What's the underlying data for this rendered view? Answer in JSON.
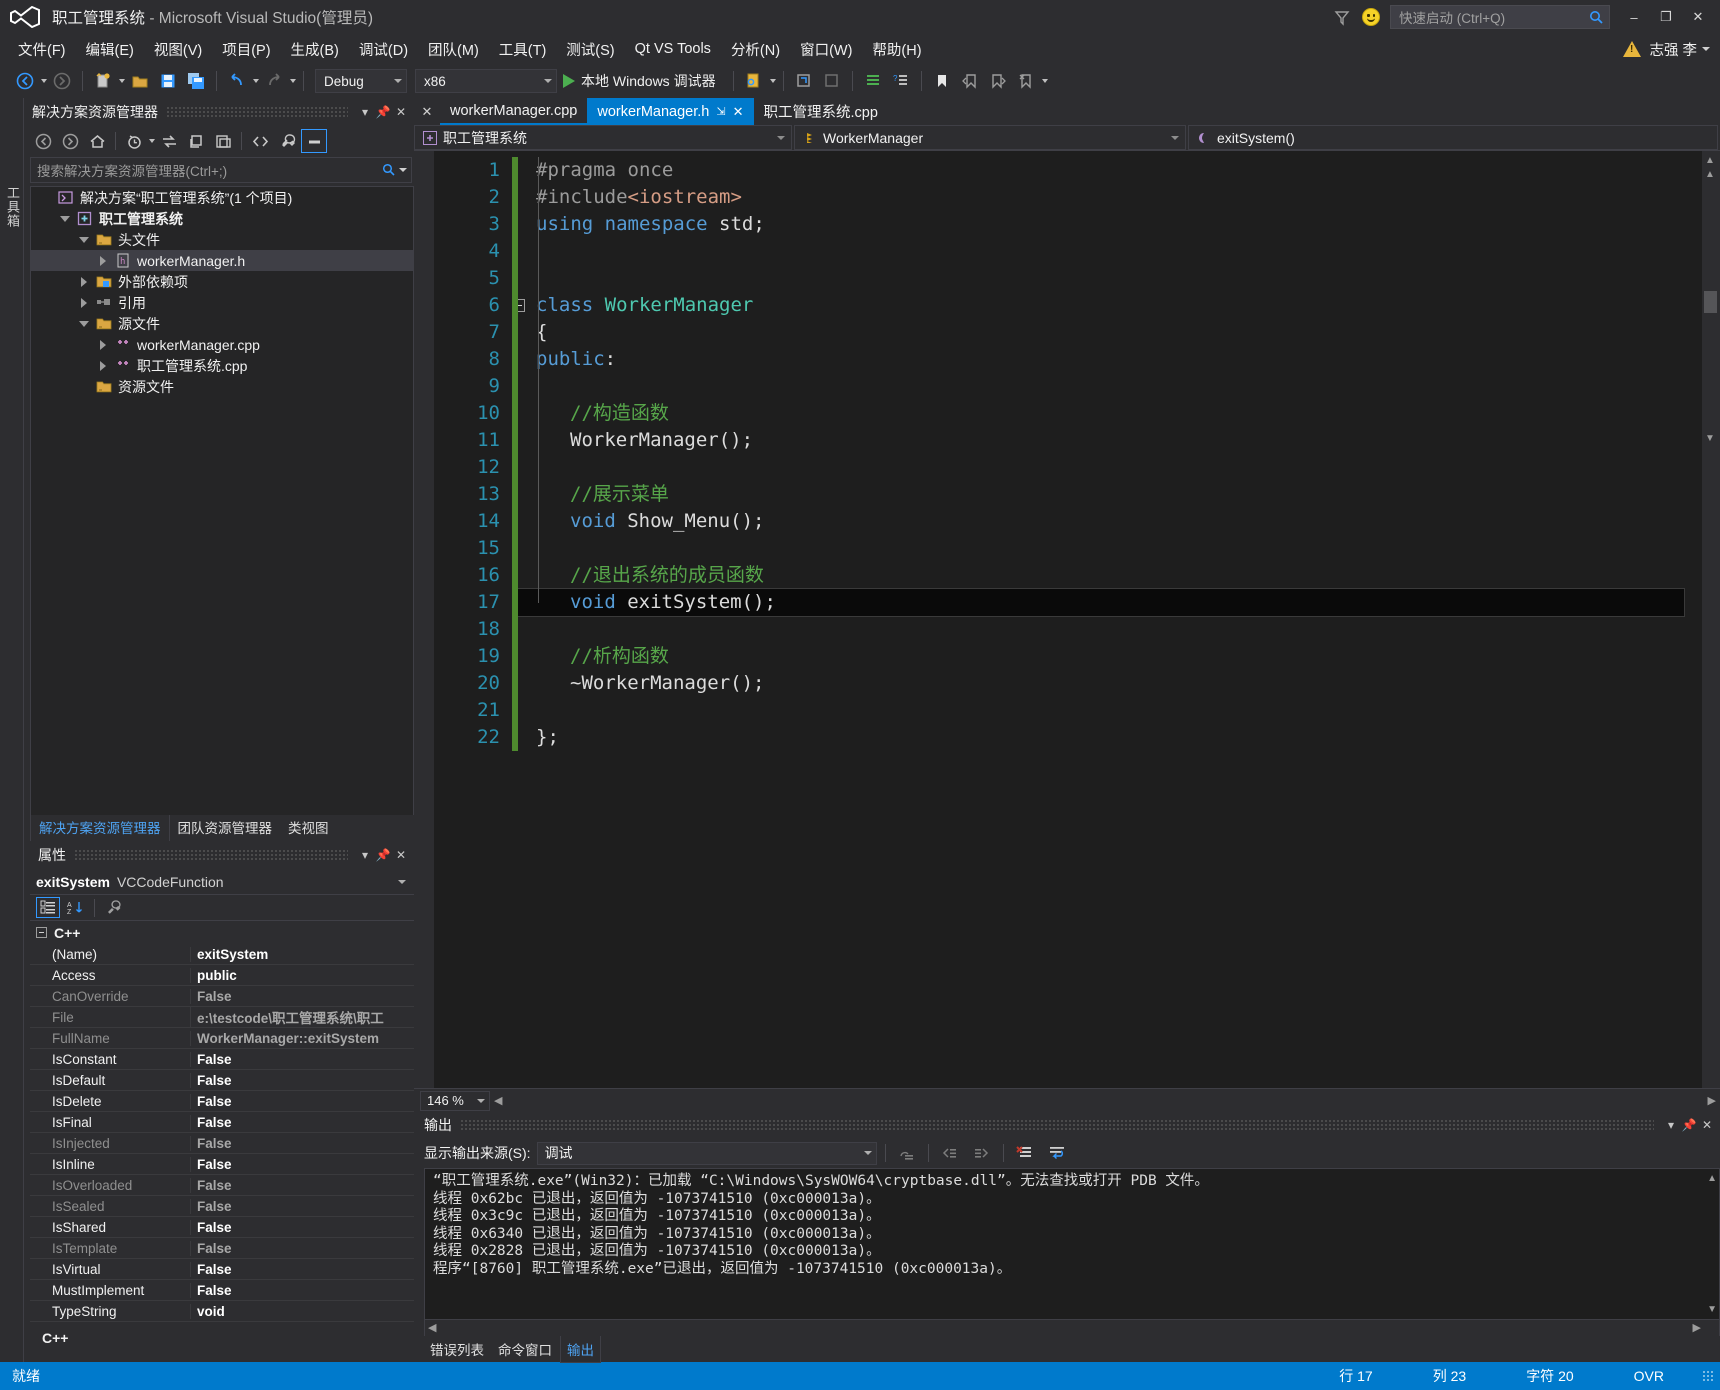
{
  "window": {
    "title_main": "职工管理系统",
    "title_rest": " - Microsoft Visual Studio(管理员)",
    "quick_launch_placeholder": "快速启动 (Ctrl+Q)",
    "minimize": "–",
    "maximize": "❐",
    "close": "✕"
  },
  "menu": {
    "items": [
      "文件(F)",
      "编辑(E)",
      "视图(V)",
      "项目(P)",
      "生成(B)",
      "调试(D)",
      "团队(M)",
      "工具(T)",
      "测试(S)",
      "Qt VS Tools",
      "分析(N)",
      "窗口(W)",
      "帮助(H)"
    ],
    "user": "志强 李"
  },
  "toolbar": {
    "configuration": "Debug",
    "platform": "x86",
    "run_label": "本地 Windows 调试器"
  },
  "solution_explorer": {
    "panel_title": "解决方案资源管理器",
    "search_placeholder": "搜索解决方案资源管理器(Ctrl+;)",
    "tree": [
      {
        "label": "解决方案“职工管理系统”(1 个项目)",
        "indent": 0,
        "twisty": "none",
        "icon": "solution-icon",
        "selected": false
      },
      {
        "label": "职工管理系统",
        "indent": 1,
        "twisty": "down",
        "icon": "project-icon",
        "selected": false,
        "bold": true
      },
      {
        "label": "头文件",
        "indent": 2,
        "twisty": "down",
        "icon": "folder-icon",
        "selected": false
      },
      {
        "label": "workerManager.h",
        "indent": 3,
        "twisty": "right",
        "icon": "header-file-icon",
        "selected": true
      },
      {
        "label": "外部依赖项",
        "indent": 2,
        "twisty": "right",
        "icon": "ext-deps-icon",
        "selected": false
      },
      {
        "label": "引用",
        "indent": 2,
        "twisty": "right",
        "icon": "references-icon",
        "selected": false
      },
      {
        "label": "源文件",
        "indent": 2,
        "twisty": "down",
        "icon": "folder-icon",
        "selected": false
      },
      {
        "label": "workerManager.cpp",
        "indent": 3,
        "twisty": "right",
        "icon": "cpp-file-icon",
        "selected": false
      },
      {
        "label": "职工管理系统.cpp",
        "indent": 3,
        "twisty": "right",
        "icon": "cpp-file-icon",
        "selected": false
      },
      {
        "label": "资源文件",
        "indent": 2,
        "twisty": "none",
        "icon": "folder-icon",
        "selected": false
      }
    ],
    "dock_tabs": [
      {
        "label": "解决方案资源管理器",
        "active": true
      },
      {
        "label": "团队资源管理器",
        "active": false
      },
      {
        "label": "类视图",
        "active": false
      }
    ]
  },
  "properties": {
    "panel_title": "属性",
    "object_name": "exitSystem",
    "object_type": "VCCodeFunction",
    "group": "C++",
    "footer": "C++",
    "rows": [
      {
        "key": "(Name)",
        "value": "exitSystem",
        "dim": false
      },
      {
        "key": "Access",
        "value": "public",
        "dim": false
      },
      {
        "key": "CanOverride",
        "value": "False",
        "dim": true
      },
      {
        "key": "File",
        "value": "e:\\testcode\\职工管理系统\\职工",
        "dim": true
      },
      {
        "key": "FullName",
        "value": "WorkerManager::exitSystem",
        "dim": true
      },
      {
        "key": "IsConstant",
        "value": "False",
        "dim": false
      },
      {
        "key": "IsDefault",
        "value": "False",
        "dim": false
      },
      {
        "key": "IsDelete",
        "value": "False",
        "dim": false
      },
      {
        "key": "IsFinal",
        "value": "False",
        "dim": false
      },
      {
        "key": "IsInjected",
        "value": "False",
        "dim": true
      },
      {
        "key": "IsInline",
        "value": "False",
        "dim": false
      },
      {
        "key": "IsOverloaded",
        "value": "False",
        "dim": true
      },
      {
        "key": "IsSealed",
        "value": "False",
        "dim": true
      },
      {
        "key": "IsShared",
        "value": "False",
        "dim": false
      },
      {
        "key": "IsTemplate",
        "value": "False",
        "dim": true
      },
      {
        "key": "IsVirtual",
        "value": "False",
        "dim": false
      },
      {
        "key": "MustImplement",
        "value": "False",
        "dim": false
      },
      {
        "key": "TypeString",
        "value": "void",
        "dim": false
      }
    ]
  },
  "editor": {
    "tabs": [
      {
        "label": "workerManager.cpp",
        "active": false,
        "pinned": false,
        "closable": false
      },
      {
        "label": "workerManager.h",
        "active": true,
        "pinned": true,
        "closable": true
      },
      {
        "label": "职工管理系统.cpp",
        "active": false,
        "pinned": false,
        "closable": false
      }
    ],
    "pin_glyph": "⇲",
    "close_glyph": "✕",
    "nav": {
      "project": "职工管理系统",
      "type": "WorkerManager",
      "member": "exitSystem()"
    },
    "zoom": "146 %",
    "lines": [
      {
        "n": 1,
        "tokens": [
          {
            "t": "#pragma once",
            "c": "k-pre"
          }
        ],
        "indent": 0,
        "hl": false
      },
      {
        "n": 2,
        "tokens": [
          {
            "t": "#include",
            "c": "k-pre"
          },
          {
            "t": "<iostream>",
            "c": "k-str"
          }
        ],
        "indent": 0,
        "hl": false
      },
      {
        "n": 3,
        "tokens": [
          {
            "t": "using",
            "c": "k-kw"
          },
          {
            "t": " ",
            "c": "k-pln"
          },
          {
            "t": "namespace",
            "c": "k-kw"
          },
          {
            "t": " std;",
            "c": "k-pln"
          }
        ],
        "indent": 0,
        "hl": false
      },
      {
        "n": 4,
        "tokens": [],
        "indent": 0,
        "hl": false
      },
      {
        "n": 5,
        "tokens": [],
        "indent": 0,
        "hl": false
      },
      {
        "n": 6,
        "tokens": [
          {
            "t": "class",
            "c": "k-kw"
          },
          {
            "t": " ",
            "c": "k-pln"
          },
          {
            "t": "WorkerManager",
            "c": "k-cls"
          }
        ],
        "indent": 0,
        "hl": false,
        "fold": true
      },
      {
        "n": 7,
        "tokens": [
          {
            "t": "{",
            "c": "k-pln"
          }
        ],
        "indent": 0,
        "hl": false
      },
      {
        "n": 8,
        "tokens": [
          {
            "t": "public",
            "c": "k-kw"
          },
          {
            "t": ":",
            "c": "k-pln"
          }
        ],
        "indent": 0,
        "hl": false
      },
      {
        "n": 9,
        "tokens": [],
        "indent": 0,
        "hl": false
      },
      {
        "n": 10,
        "tokens": [
          {
            "t": "//构造函数",
            "c": "k-cmt"
          }
        ],
        "indent": 1,
        "hl": false
      },
      {
        "n": 11,
        "tokens": [
          {
            "t": "WorkerManager();",
            "c": "k-pln"
          }
        ],
        "indent": 1,
        "hl": false
      },
      {
        "n": 12,
        "tokens": [],
        "indent": 0,
        "hl": false
      },
      {
        "n": 13,
        "tokens": [
          {
            "t": "//展示菜单",
            "c": "k-cmt"
          }
        ],
        "indent": 1,
        "hl": false
      },
      {
        "n": 14,
        "tokens": [
          {
            "t": "void",
            "c": "k-kw"
          },
          {
            "t": " Show_Menu();",
            "c": "k-pln"
          }
        ],
        "indent": 1,
        "hl": false
      },
      {
        "n": 15,
        "tokens": [],
        "indent": 0,
        "hl": false
      },
      {
        "n": 16,
        "tokens": [
          {
            "t": "//退出系统的成员函数",
            "c": "k-cmt"
          }
        ],
        "indent": 1,
        "hl": false
      },
      {
        "n": 17,
        "tokens": [
          {
            "t": "void",
            "c": "k-kw"
          },
          {
            "t": " exitSystem();",
            "c": "k-pln"
          }
        ],
        "indent": 1,
        "hl": true
      },
      {
        "n": 18,
        "tokens": [],
        "indent": 0,
        "hl": false
      },
      {
        "n": 19,
        "tokens": [
          {
            "t": "//析构函数",
            "c": "k-cmt"
          }
        ],
        "indent": 1,
        "hl": false
      },
      {
        "n": 20,
        "tokens": [
          {
            "t": "~WorkerManager();",
            "c": "k-pln"
          }
        ],
        "indent": 1,
        "hl": false
      },
      {
        "n": 21,
        "tokens": [],
        "indent": 0,
        "hl": false
      },
      {
        "n": 22,
        "tokens": [
          {
            "t": "};",
            "c": "k-pln"
          }
        ],
        "indent": 0,
        "hl": false
      }
    ]
  },
  "output": {
    "panel_title": "输出",
    "source_label": "显示输出来源(S):",
    "source_value": "调试",
    "lines": [
      "“职工管理系统.exe”(Win32)：已加载 “C:\\Windows\\SysWOW64\\cryptbase.dll”。无法查找或打开 PDB 文件。",
      "线程 0x62bc 已退出，返回值为 -1073741510 (0xc000013a)。",
      "线程 0x3c9c 已退出，返回值为 -1073741510 (0xc000013a)。",
      "线程 0x6340 已退出，返回值为 -1073741510 (0xc000013a)。",
      "线程 0x2828 已退出，返回值为 -1073741510 (0xc000013a)。",
      "程序“[8760] 职工管理系统.exe”已退出，返回值为 -1073741510 (0xc000013a)。"
    ],
    "tabs": [
      {
        "label": "错误列表",
        "active": false
      },
      {
        "label": "命令窗口",
        "active": false
      },
      {
        "label": "输出",
        "active": true
      }
    ]
  },
  "statusbar": {
    "status": "就绪",
    "line": "行 17",
    "column": "列 23",
    "char": "字符 20",
    "insert_mode": "OVR"
  },
  "vertical_rail": {
    "label": "工具箱"
  },
  "colors": {
    "accent": "#007acc",
    "chrome": "#2d2d30",
    "editor_bg": "#1e1e1e",
    "comment_green": "#57a64a",
    "keyword_blue": "#569cd6",
    "class_teal": "#4ec9b0",
    "string_orange": "#d69d85",
    "linenum_blue": "#2b91af"
  }
}
